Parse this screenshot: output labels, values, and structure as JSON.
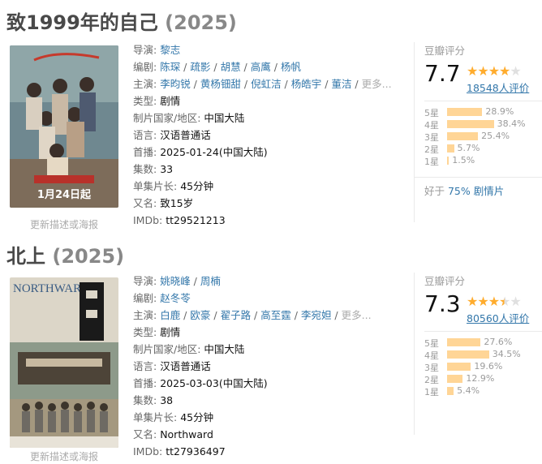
{
  "entries": [
    {
      "title": "致1999年的自己",
      "year": "(2025)",
      "poster_link": "更新描述或海报",
      "poster_text": "1月24日起",
      "director_label": "导演: ",
      "directors": [
        "黎志"
      ],
      "writer_label": "编剧: ",
      "writers": [
        "陈琛",
        "疏影",
        "胡慧",
        "高鹰",
        "杨帆"
      ],
      "cast_label": "主演: ",
      "cast": [
        "李昀锐",
        "黄杨钿甜",
        "倪虹洁",
        "杨皓宇",
        "董洁"
      ],
      "more": "更多...",
      "genre_label": "类型: ",
      "genre": "剧情",
      "country_label": "制片国家/地区: ",
      "country": "中国大陆",
      "language_label": "语言: ",
      "language": "汉语普通话",
      "premiere_label": "首播: ",
      "premiere": "2025-01-24(中国大陆)",
      "episodes_label": "集数: ",
      "episodes": "33",
      "runtime_label": "单集片长: ",
      "runtime": "45分钟",
      "aka_label": "又名: ",
      "aka": "致15岁",
      "imdb_label": "IMDb: ",
      "imdb": "tt29521213",
      "rating": {
        "head": "豆瓣评分",
        "score": "7.7",
        "stars_value": 4,
        "votes": "18548人评价",
        "breakdown": [
          {
            "label": "5星",
            "pct": "28.9%",
            "value": 28.9
          },
          {
            "label": "4星",
            "pct": "38.4%",
            "value": 38.4
          },
          {
            "label": "3星",
            "pct": "25.4%",
            "value": 25.4
          },
          {
            "label": "2星",
            "pct": "5.7%",
            "value": 5.7
          },
          {
            "label": "1星",
            "pct": "1.5%",
            "value": 1.5
          }
        ],
        "better_prefix": "好于 ",
        "better_pct": "75%",
        "better_suffix": " 剧情片"
      }
    },
    {
      "title": "北上",
      "year": "(2025)",
      "poster_link": "更新描述或海报",
      "poster_text": "NORTHWARD",
      "director_label": "导演: ",
      "directors": [
        "姚晓峰",
        "周楠"
      ],
      "writer_label": "编剧: ",
      "writers": [
        "赵冬苓"
      ],
      "cast_label": "主演: ",
      "cast": [
        "白鹿",
        "欧豪",
        "翟子路",
        "高至霆",
        "李宛妲"
      ],
      "more": "更多...",
      "genre_label": "类型: ",
      "genre": "剧情",
      "country_label": "制片国家/地区: ",
      "country": "中国大陆",
      "language_label": "语言: ",
      "language": "汉语普通话",
      "premiere_label": "首播: ",
      "premiere": "2025-03-03(中国大陆)",
      "episodes_label": "集数: ",
      "episodes": "38",
      "runtime_label": "单集片长: ",
      "runtime": "45分钟",
      "aka_label": "又名: ",
      "aka": "Northward",
      "imdb_label": "IMDb: ",
      "imdb": "tt27936497",
      "rating": {
        "head": "豆瓣评分",
        "score": "7.3",
        "stars_value": 3.5,
        "votes": "80560人评价",
        "breakdown": [
          {
            "label": "5星",
            "pct": "27.6%",
            "value": 27.6
          },
          {
            "label": "4星",
            "pct": "34.5%",
            "value": 34.5
          },
          {
            "label": "3星",
            "pct": "19.6%",
            "value": 19.6
          },
          {
            "label": "2星",
            "pct": "12.9%",
            "value": 12.9
          },
          {
            "label": "1星",
            "pct": "5.4%",
            "value": 5.4
          }
        ]
      }
    }
  ]
}
